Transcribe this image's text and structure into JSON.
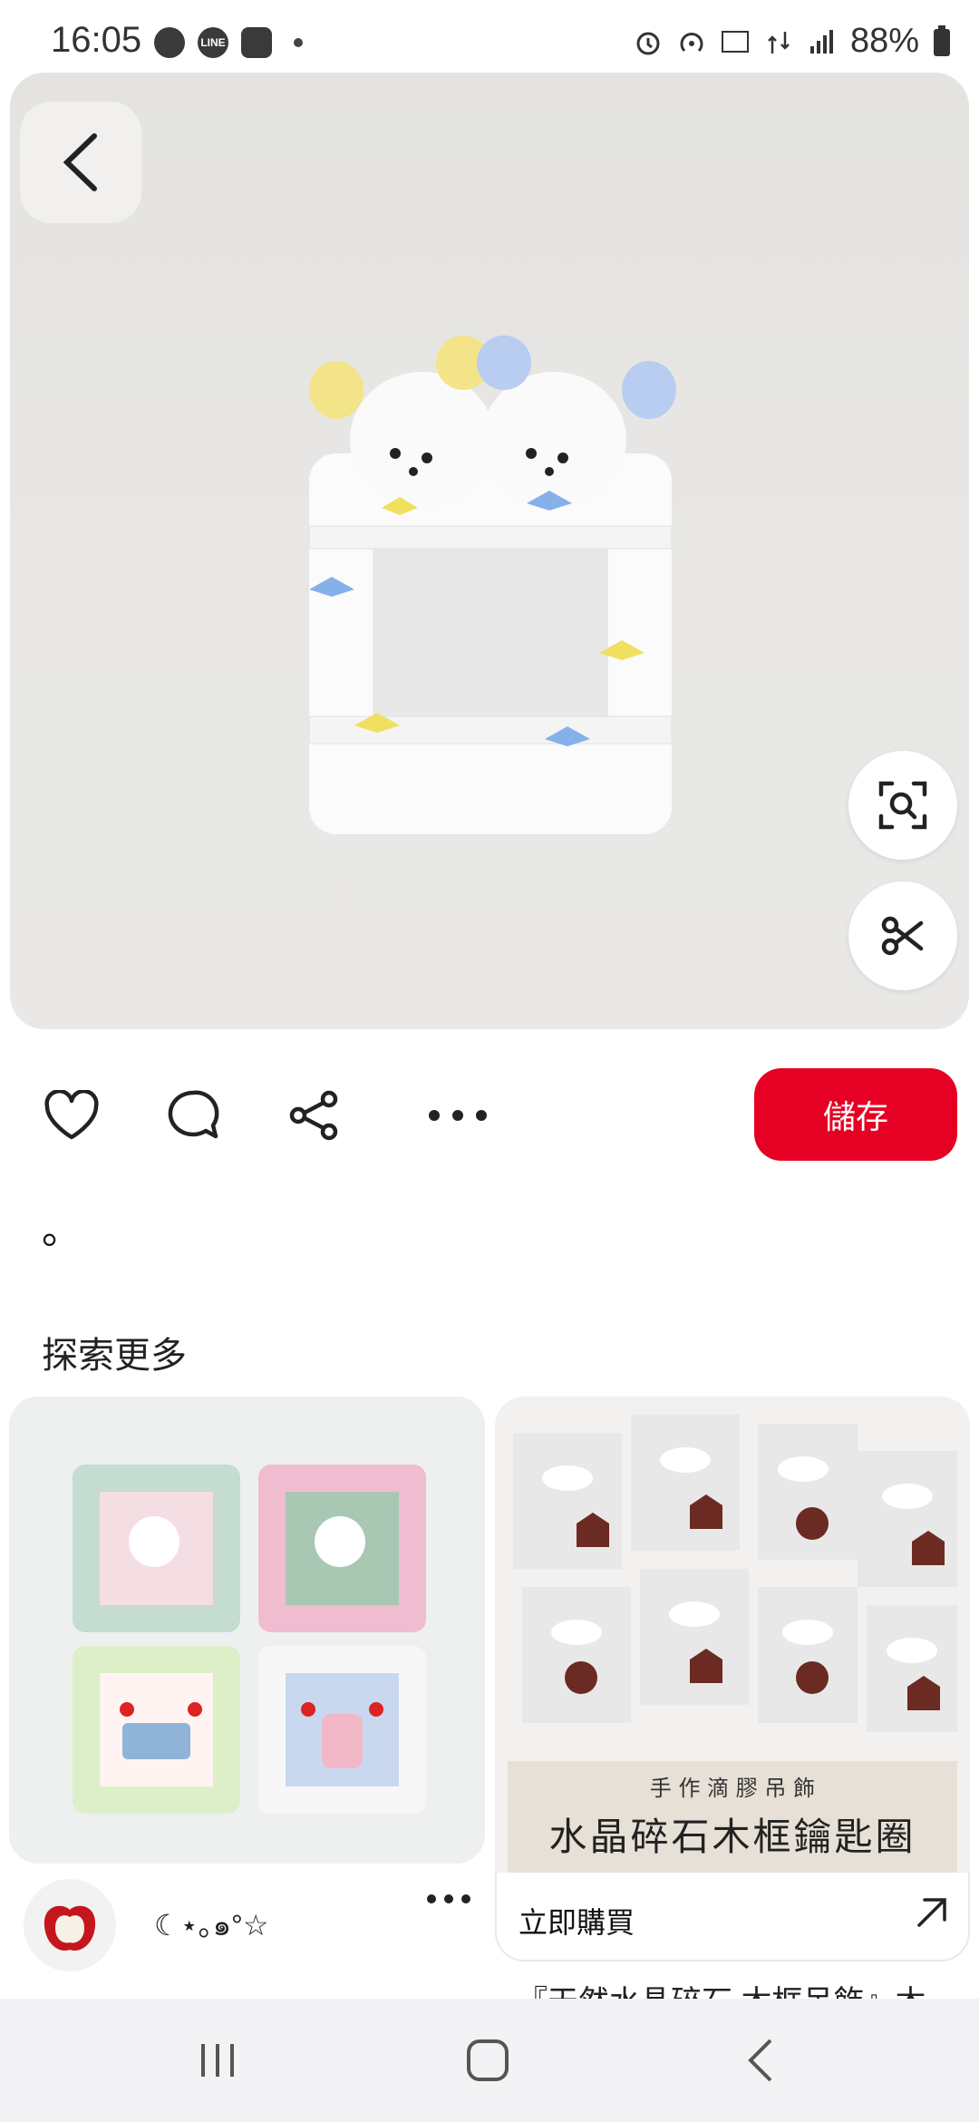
{
  "status_bar": {
    "time": "16:05",
    "left_icons": [
      "chat-icon",
      "line-app-icon",
      "game-icon",
      "notification-dot-icon"
    ],
    "right_icons": [
      "alarm-icon",
      "hotspot-icon",
      "volte-icon",
      "data-4g-icon",
      "signal-icon",
      "battery-icon"
    ],
    "battery": "88%",
    "line_label": "LINE"
  },
  "pin": {
    "hero_image": "fluffy-bear-photocard-frame-image",
    "description": "。"
  },
  "actions": {
    "save_label": "儲存",
    "icons": [
      "heart-icon",
      "comment-icon",
      "share-icon",
      "more-icon"
    ],
    "accent_color": "#e60023"
  },
  "explore": {
    "heading": "探索更多",
    "left_card": {
      "image": "fluffy-frames-grid-image",
      "author_name": "☾⋆｡๑°☆"
    },
    "right_card": {
      "image": "crystal-keychains-image",
      "banner_small": "手 作 滴 膠 吊 飾",
      "banner_large": "水晶碎石木框鑰匙圈",
      "shop_label": "立即購買",
      "next_title": "『天然水晶碎石 木框吊飾』木"
    }
  },
  "nav": [
    "recent-apps-icon",
    "home-icon",
    "back-icon"
  ]
}
